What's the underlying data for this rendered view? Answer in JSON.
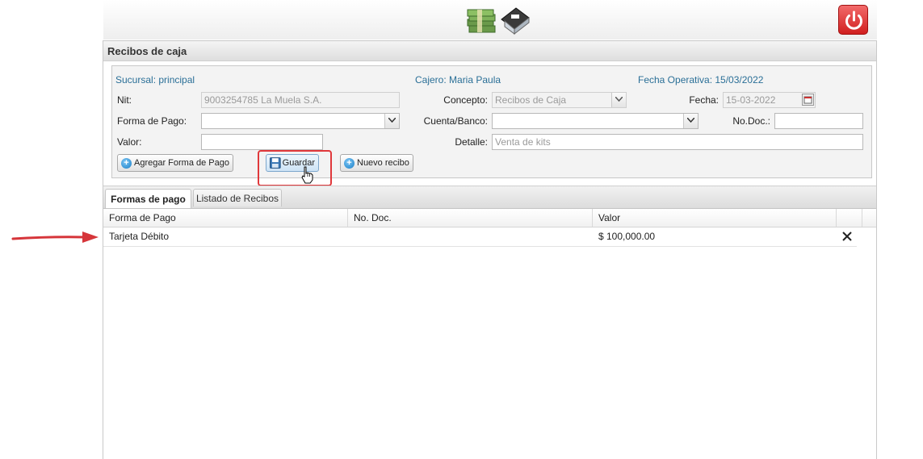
{
  "colors": {
    "accent": "#2a6f97",
    "highlight": "#e0383b",
    "power": "#d11f1f"
  },
  "header": {
    "logo_icon": "money-house-icon",
    "power_icon": "power-icon"
  },
  "panel": {
    "title": "Recibos de caja"
  },
  "info": {
    "sucursal": "Sucursal: principal",
    "cajero": "Cajero: Maria Paula",
    "fecha_operativa": "Fecha Operativa: 15/03/2022"
  },
  "form": {
    "nit_label": "Nit:",
    "nit_value": "9003254785 La Muela S.A.",
    "concepto_label": "Concepto:",
    "concepto_value": "Recibos de Caja",
    "fecha_label": "Fecha:",
    "fecha_value": "15-03-2022",
    "forma_pago_label": "Forma de Pago:",
    "forma_pago_value": "",
    "cuenta_label": "Cuenta/Banco:",
    "cuenta_value": "",
    "nodoc_label": "No.Doc.:",
    "nodoc_value": "",
    "valor_label": "Valor:",
    "valor_value": "",
    "detalle_label": "Detalle:",
    "detalle_placeholder": "Venta de kits"
  },
  "buttons": {
    "agregar": "Agregar Forma de Pago",
    "guardar": "Guardar",
    "nuevo": "Nuevo recibo"
  },
  "tabs": [
    {
      "label": "Formas de pago",
      "active": true
    },
    {
      "label": "Listado de Recibos",
      "active": false
    }
  ],
  "table": {
    "columns": [
      "Forma de Pago",
      "No. Doc.",
      "Valor"
    ],
    "rows": [
      {
        "forma": "Tarjeta Débito",
        "doc": "",
        "valor": "$ 100,000.00",
        "delete_icon": "close-icon"
      }
    ]
  }
}
